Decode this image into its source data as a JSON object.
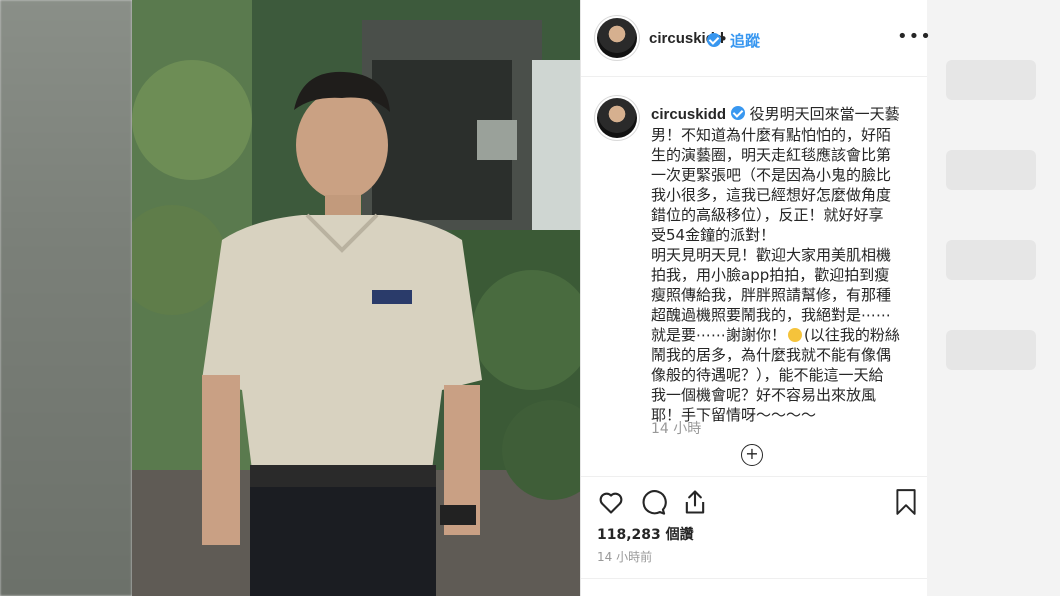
{
  "post": {
    "username": "circuskidd",
    "follow_separator": "•",
    "follow_label": "追蹤",
    "more_label": "•••",
    "caption_username": "circuskidd",
    "caption_lines": [
      "役男明天回來當一天藝",
      "男！不知道為什麼有點怕怕的，好陌",
      "生的演藝圈，明天走紅毯應該會比第",
      "一次更緊張吧（不是因為小鬼的臉比",
      "我小很多，這我已經想好怎麼做角度",
      "錯位的高級移位），反正！就好好享",
      "受54金鐘的派對！",
      "明天見明天見！歡迎大家用美肌相機",
      "拍我，用小臉app拍拍，歡迎拍到瘦",
      "瘦照傳給我，胖胖照請幫修，有那種",
      "超醜過機照要鬧我的，我絕對是⋯⋯",
      "就是要⋯⋯謝謝你！",
      "(以往我的粉絲",
      "鬧我的居多，為什麼我就不能有像偶",
      "像般的待遇呢？），能不能這一天給",
      "我一個機會呢？好不容易出來放風",
      "耶！手下留情呀～～～～"
    ],
    "caption_time": "14 小時",
    "load_more": "+",
    "likes": "118,283 個讚",
    "posted_time": "14 小時前"
  }
}
